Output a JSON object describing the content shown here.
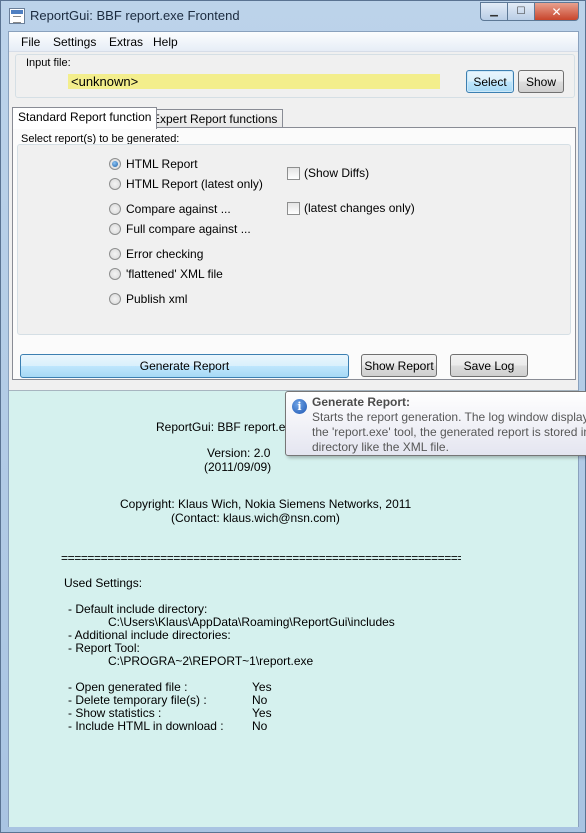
{
  "window": {
    "title": "ReportGui: BBF report.exe Frontend"
  },
  "menu": {
    "file": "File",
    "settings": "Settings",
    "extras": "Extras",
    "help": "Help"
  },
  "input": {
    "group_label": "Input file:",
    "value": "<unknown>",
    "select_label": "Select",
    "show_label": "Show"
  },
  "tabs": [
    {
      "label": "Standard Report function",
      "active": true
    },
    {
      "label": "Expert Report functions",
      "active": false
    }
  ],
  "reports": {
    "group_label": "Select report(s) to be generated:",
    "options": [
      {
        "label": "HTML Report",
        "checked": true
      },
      {
        "label": "HTML Report (latest only)",
        "checked": false
      },
      {
        "label": "Compare against ...",
        "checked": false
      },
      {
        "label": "Full compare against ...",
        "checked": false
      },
      {
        "label": "Error checking",
        "checked": false
      },
      {
        "label": "'flattened' XML file",
        "checked": false
      },
      {
        "label": "Publish xml",
        "checked": false
      }
    ],
    "checkboxes": [
      {
        "label": "(Show Diffs)",
        "checked": false
      },
      {
        "label": "(latest changes only)",
        "checked": false
      }
    ]
  },
  "actions": {
    "generate": "Generate Report",
    "show": "Show Report",
    "save_log": "Save Log"
  },
  "log": {
    "app": "ReportGui: BBF report.exe F",
    "version": "Version: 2.0",
    "date": "(2011/09/09)",
    "copyright": "Copyright: Klaus Wich, Nokia Siemens Networks, 2011",
    "contact": "(Contact: klaus.wich@nsn.com)",
    "separator": "==========================================================================",
    "used_settings": "Used Settings:",
    "default_include_label": "- Default include directory:",
    "default_include_value": "C:\\Users\\Klaus\\AppData\\Roaming\\ReportGui\\includes",
    "additional_include_label": "- Additional include directories:",
    "report_tool_label": "- Report Tool:",
    "report_tool_value": "C:\\PROGRA~2\\REPORT~1\\report.exe",
    "settings": [
      {
        "label": "- Open generated file :",
        "value": "Yes"
      },
      {
        "label": "- Delete temporary file(s) :",
        "value": "No"
      },
      {
        "label": "- Show statistics :",
        "value": "Yes"
      },
      {
        "label": "- Include HTML in download :",
        "value": "No"
      }
    ]
  },
  "tooltip": {
    "title": "Generate Report:",
    "lines": [
      "Starts the report generation. The log window display",
      "the 'report.exe' tool, the generated report is stored in",
      "directory like the XML file."
    ]
  }
}
